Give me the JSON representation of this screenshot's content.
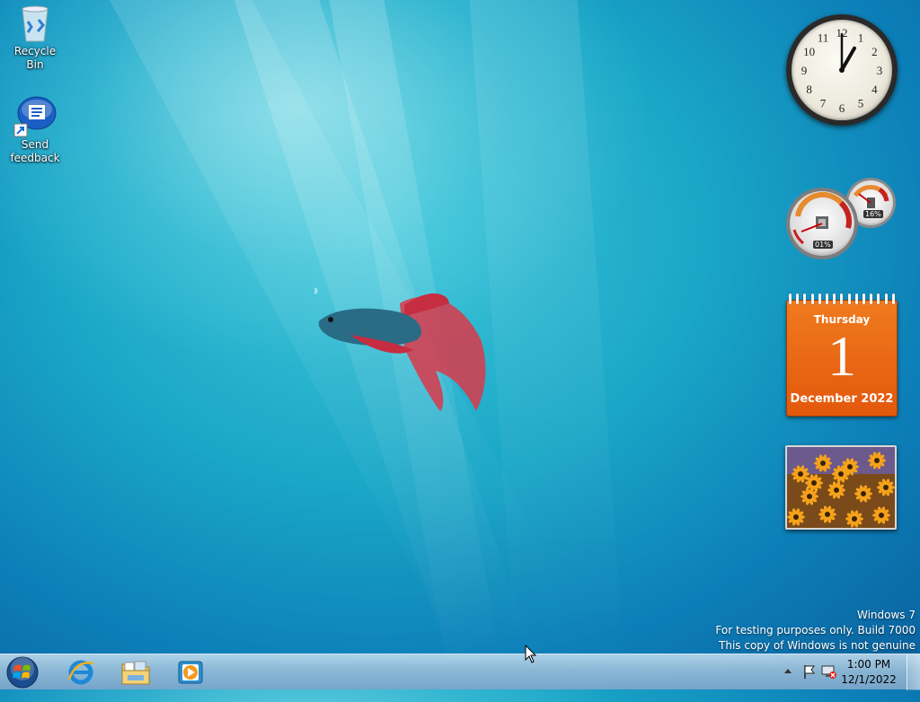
{
  "desktop": {
    "icons": [
      {
        "label": "Recycle Bin",
        "icon": "recycle-bin-icon"
      },
      {
        "label": "Send feedback",
        "icon": "feedback-icon"
      }
    ]
  },
  "gadgets": {
    "clock": {
      "hour": 1,
      "minute": 0,
      "numerals": [
        "12",
        "1",
        "2",
        "3",
        "4",
        "5",
        "6",
        "7",
        "8",
        "9",
        "10",
        "11"
      ]
    },
    "cpu_meter": {
      "cpu_label": "01%",
      "memory_label": "16%",
      "cpu_percent": 1,
      "memory_percent": 16
    },
    "calendar": {
      "day_name": "Thursday",
      "date": "1",
      "month_year": "December 2022"
    },
    "slideshow": {
      "image": "orange-flowers-photo"
    }
  },
  "watermark": {
    "line1": "Windows  7",
    "line2": "For testing purposes only. Build 7000",
    "line3": "This copy of Windows is not genuine"
  },
  "taskbar": {
    "start_icon": "windows-orb-icon",
    "pinned": [
      {
        "name": "Internet Explorer",
        "icon": "internet-explorer-icon"
      },
      {
        "name": "Windows Explorer",
        "icon": "folder-icon"
      },
      {
        "name": "Windows Media Player",
        "icon": "media-player-icon"
      }
    ],
    "tray": {
      "icons": [
        "show-hidden-icons-arrow",
        "action-center-flag-icon",
        "network-icon"
      ],
      "time": "1:00 PM",
      "date": "12/1/2022"
    }
  },
  "colors": {
    "calendar_orange": "#e3580c",
    "wallpaper_blue": "#1aa7c7"
  }
}
